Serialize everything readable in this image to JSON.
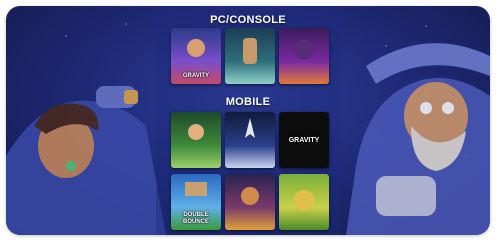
{
  "sections": {
    "pc": {
      "heading": "PC/CONSOLE",
      "games": [
        {
          "logo": "GRAVITY",
          "colors": [
            "#2a3a8a",
            "#7a4fc9",
            "#c44a6a"
          ]
        },
        {
          "logo": "",
          "colors": [
            "#1c3d55",
            "#2f6f7a",
            "#8fd0c8"
          ]
        },
        {
          "logo": "",
          "colors": [
            "#3a1b5a",
            "#7a2aa0",
            "#e07a3a"
          ]
        }
      ]
    },
    "mobile": {
      "heading": "MOBILE",
      "games": [
        {
          "logo": "",
          "colors": [
            "#1d4a2a",
            "#3f8a3a",
            "#9bd06a"
          ]
        },
        {
          "logo": "",
          "colors": [
            "#111a3a",
            "#2a3f8a",
            "#c9d3ef"
          ]
        },
        {
          "logo": "GRAVITY",
          "colors": [
            "#0a0a0a",
            "#1a1a1a",
            "#3a3a3a"
          ]
        },
        {
          "logo": "DOUBLE BOUNCE",
          "colors": [
            "#2a6ac0",
            "#5fb0e8",
            "#3a9a3a"
          ]
        },
        {
          "logo": "",
          "colors": [
            "#2a2250",
            "#7a3a6a",
            "#e0a13a"
          ]
        },
        {
          "logo": "",
          "colors": [
            "#7ab03a",
            "#c9d04a",
            "#4a8a2a"
          ]
        }
      ]
    }
  }
}
